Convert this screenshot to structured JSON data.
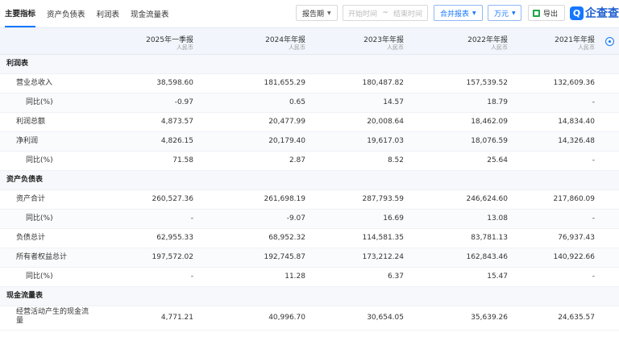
{
  "tabs": [
    {
      "label": "主要指标",
      "active": true
    },
    {
      "label": "资产负债表",
      "active": false
    },
    {
      "label": "利润表",
      "active": false
    },
    {
      "label": "现金流量表",
      "active": false
    }
  ],
  "toolbar": {
    "period_label": "报告期",
    "date_start_placeholder": "开始时间",
    "date_separator": "~",
    "date_end_placeholder": "结束时间",
    "merge_label": "合并报表",
    "unit_label": "万元",
    "export_label": "导出",
    "brand_mark": "Q",
    "brand_text": "企查查"
  },
  "colors": {
    "accent": "#1677ff",
    "header_bg": "#f2f6fc",
    "section_bg": "#f6f8fb"
  },
  "columns": [
    {
      "period": "2025年一季报",
      "currency": "人民币"
    },
    {
      "period": "2024年年报",
      "currency": "人民币"
    },
    {
      "period": "2023年年报",
      "currency": "人民币"
    },
    {
      "period": "2022年年报",
      "currency": "人民币"
    },
    {
      "period": "2021年年报",
      "currency": "人民币"
    }
  ],
  "rows": [
    {
      "type": "section",
      "label": "利润表",
      "values": []
    },
    {
      "type": "item",
      "level": 1,
      "label": "营业总收入",
      "values": [
        "38,598.60",
        "181,655.29",
        "180,487.82",
        "157,539.52",
        "132,609.36"
      ]
    },
    {
      "type": "item",
      "level": 2,
      "label": "同比(%)",
      "values": [
        "-0.97",
        "0.65",
        "14.57",
        "18.79",
        "-"
      ]
    },
    {
      "type": "item",
      "level": 1,
      "label": "利润总额",
      "values": [
        "4,873.57",
        "20,477.99",
        "20,008.64",
        "18,462.09",
        "14,834.40"
      ]
    },
    {
      "type": "item",
      "level": 1,
      "label": "净利润",
      "values": [
        "4,826.15",
        "20,179.40",
        "19,617.03",
        "18,076.59",
        "14,326.48"
      ]
    },
    {
      "type": "item",
      "level": 2,
      "label": "同比(%)",
      "values": [
        "71.58",
        "2.87",
        "8.52",
        "25.64",
        "-"
      ]
    },
    {
      "type": "section",
      "label": "资产负债表",
      "values": []
    },
    {
      "type": "item",
      "level": 1,
      "label": "资产合计",
      "values": [
        "260,527.36",
        "261,698.19",
        "287,793.59",
        "246,624.60",
        "217,860.09"
      ]
    },
    {
      "type": "item",
      "level": 2,
      "label": "同比(%)",
      "values": [
        "-",
        "-9.07",
        "16.69",
        "13.08",
        "-"
      ]
    },
    {
      "type": "item",
      "level": 1,
      "label": "负债总计",
      "values": [
        "62,955.33",
        "68,952.32",
        "114,581.35",
        "83,781.13",
        "76,937.43"
      ]
    },
    {
      "type": "item",
      "level": 1,
      "label": "所有者权益总计",
      "values": [
        "197,572.02",
        "192,745.87",
        "173,212.24",
        "162,843.46",
        "140,922.66"
      ]
    },
    {
      "type": "item",
      "level": 2,
      "label": "同比(%)",
      "values": [
        "-",
        "11.28",
        "6.37",
        "15.47",
        "-"
      ]
    },
    {
      "type": "section",
      "label": "现金流量表",
      "values": []
    },
    {
      "type": "item",
      "level": 1,
      "label": "经营活动产生的现金流量",
      "wrap": true,
      "values": [
        "4,771.21",
        "40,996.70",
        "30,654.05",
        "35,639.26",
        "24,635.57"
      ]
    }
  ]
}
